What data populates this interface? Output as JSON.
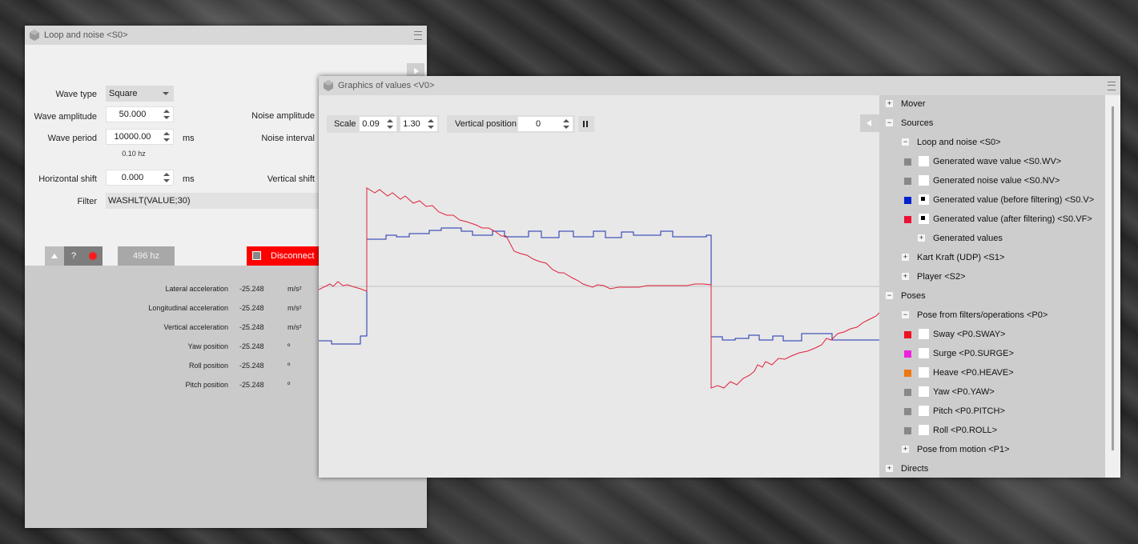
{
  "loop_window": {
    "title": "Loop and noise <S0>",
    "wave_type": {
      "label": "Wave type",
      "value": "Square"
    },
    "wave_amplitude": {
      "label": "Wave amplitude",
      "value": "50.000"
    },
    "wave_period": {
      "label": "Wave period",
      "value": "10000.00",
      "unit": "ms",
      "hz": "0.10 hz"
    },
    "horizontal_shift": {
      "label": "Horizontal shift",
      "value": "0.000",
      "unit": "ms"
    },
    "filter": {
      "label": "Filter",
      "value": "WASHLT(VALUE;30)"
    },
    "noise_amplitude_label": "Noise amplitude",
    "noise_interval_label": "Noise interval",
    "vertical_shift_label": "Vertical shift",
    "help_label": "?",
    "rate_label": "496 hz",
    "disconnect_label": "Disconnect",
    "readouts": [
      {
        "name": "Lateral acceleration",
        "value": "-25.248",
        "unit": "m/s²"
      },
      {
        "name": "Longitudinal acceleration",
        "value": "-25.248",
        "unit": "m/s²"
      },
      {
        "name": "Vertical acceleration",
        "value": "-25.248",
        "unit": "m/s²"
      },
      {
        "name": "Yaw position",
        "value": "-25.248",
        "unit": "º"
      },
      {
        "name": "Roll position",
        "value": "-25.248",
        "unit": "º"
      },
      {
        "name": "Pitch position",
        "value": "-25.248",
        "unit": "º"
      }
    ]
  },
  "graphics_window": {
    "title": "Graphics of values <V0>",
    "scale_label": "Scale",
    "scale_x": "0.09",
    "scale_y": "1.30",
    "vertical_position_label": "Vertical position",
    "vertical_position": "0",
    "tree": [
      {
        "label": "Mover",
        "level": 0,
        "toggle": "+"
      },
      {
        "label": "Sources",
        "level": 0,
        "toggle": "−"
      },
      {
        "label": "Loop and noise <S0>",
        "level": 1,
        "toggle": "−"
      },
      {
        "label": "Generated wave value <S0.WV>",
        "level": 2,
        "swatch": "#888888",
        "checked": false
      },
      {
        "label": "Generated noise value <S0.NV>",
        "level": 2,
        "swatch": "#888888",
        "checked": false
      },
      {
        "label": "Generated value (before filtering) <S0.V>",
        "level": 2,
        "swatch": "#0022cc",
        "checked": true
      },
      {
        "label": "Generated value (after filtering) <S0.VF>",
        "level": 2,
        "swatch": "#ee1133",
        "checked": true
      },
      {
        "label": "Generated values",
        "level": 2,
        "toggle": "+"
      },
      {
        "label": "Kart Kraft (UDP) <S1>",
        "level": 1,
        "toggle": "+"
      },
      {
        "label": "Player <S2>",
        "level": 1,
        "toggle": "+"
      },
      {
        "label": "Poses",
        "level": 0,
        "toggle": "−"
      },
      {
        "label": "Pose from filters/operations <P0>",
        "level": 1,
        "toggle": "−"
      },
      {
        "label": "Sway <P0.SWAY>",
        "level": 2,
        "swatch": "#ee1122",
        "checked": false
      },
      {
        "label": "Surge <P0.SURGE>",
        "level": 2,
        "swatch": "#ee22dd",
        "checked": false
      },
      {
        "label": "Heave <P0.HEAVE>",
        "level": 2,
        "swatch": "#ee7711",
        "checked": false
      },
      {
        "label": "Yaw <P0.YAW>",
        "level": 2,
        "swatch": "#888888",
        "checked": false
      },
      {
        "label": "Pitch <P0.PITCH>",
        "level": 2,
        "swatch": "#888888",
        "checked": false
      },
      {
        "label": "Roll <P0.ROLL>",
        "level": 2,
        "swatch": "#888888",
        "checked": false
      },
      {
        "label": "Pose from motion <P1>",
        "level": 1,
        "toggle": "+"
      },
      {
        "label": "Directs",
        "level": 0,
        "toggle": "+"
      }
    ]
  },
  "colors": {
    "before_filter": "#1a2fb0",
    "after_filter": "#e0203c",
    "disconnect_bg": "#ff0000"
  }
}
